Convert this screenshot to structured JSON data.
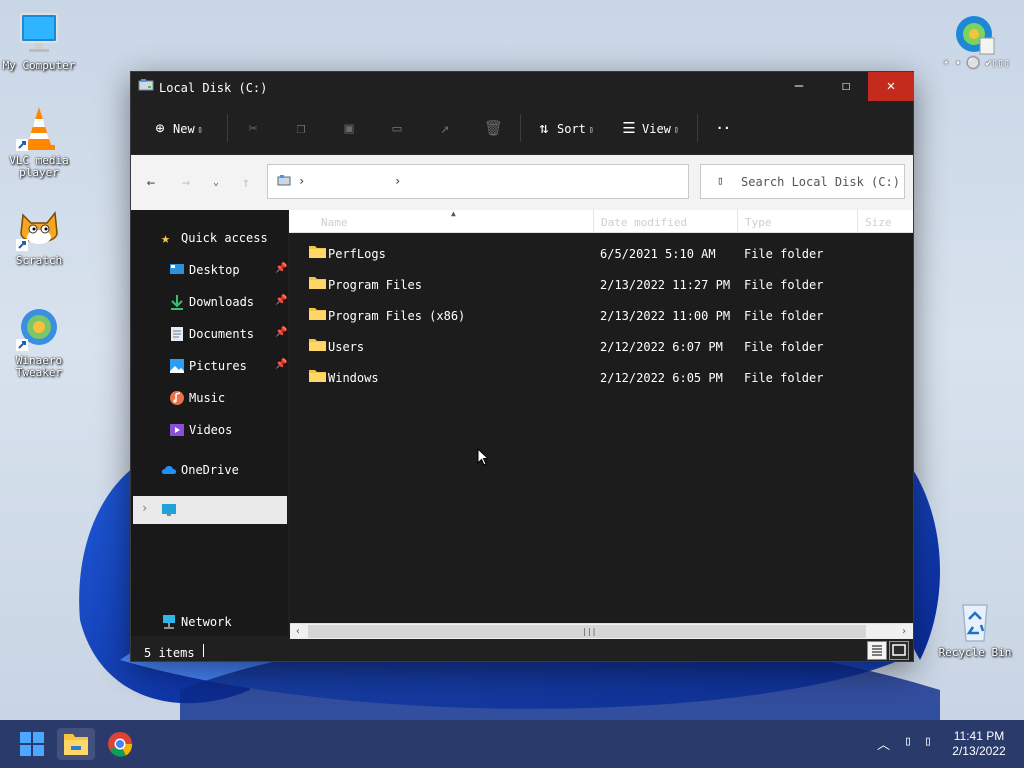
{
  "desktop": {
    "icons": [
      {
        "label": "My Computer",
        "icon": "monitor-icon"
      },
      {
        "label": "VLC media player",
        "icon": "vlc-cone-icon"
      },
      {
        "label": "Scratch",
        "icon": "scratch-cat-icon"
      },
      {
        "label": "Winaero Tweaker",
        "icon": "winaero-tweaker-icon"
      },
      {
        "label": "Recycle Bin",
        "icon": "recycle-bin-icon"
      }
    ],
    "corner_widget_text": "☀ • ⚪ ✔▯▯▯"
  },
  "window": {
    "title": "Local Disk (C:)",
    "controls": {
      "minimize": "—",
      "maximize": "☐",
      "close": "✕"
    },
    "colors": {
      "close_bg": "#c42b1c",
      "dark_bg": "#202020"
    }
  },
  "toolbar": {
    "new_label": "New",
    "sort_label": "Sort",
    "view_label": "View",
    "more_label": "··",
    "icons": [
      "add-circle-icon",
      "cut-icon",
      "copy-icon",
      "paste-icon",
      "rename-icon",
      "share-icon",
      "delete-icon",
      "sort-arrows-icon",
      "view-lines-icon"
    ]
  },
  "address": {
    "chevron": "›",
    "search_placeholder": "Search Local Disk (C:)",
    "search_icon": "▯"
  },
  "navpane": {
    "quick_access": "Quick access",
    "items": [
      {
        "label": "Desktop",
        "icon": "desktop-icon",
        "pinned": true
      },
      {
        "label": "Downloads",
        "icon": "download-icon",
        "pinned": true
      },
      {
        "label": "Documents",
        "icon": "document-icon",
        "pinned": true
      },
      {
        "label": "Pictures",
        "icon": "pictures-icon",
        "pinned": true
      },
      {
        "label": "Music",
        "icon": "music-icon",
        "pinned": false
      },
      {
        "label": "Videos",
        "icon": "videos-icon",
        "pinned": false
      }
    ],
    "onedrive": "OneDrive",
    "this_pc_expander": "›",
    "network": "Network"
  },
  "columns": [
    "Name",
    "Date modified",
    "Type",
    "Size"
  ],
  "files": [
    {
      "name": "PerfLogs",
      "date": "6/5/2021 5:10 AM",
      "type": "File folder"
    },
    {
      "name": "Program Files",
      "date": "2/13/2022 11:27 PM",
      "type": "File folder"
    },
    {
      "name": "Program Files (x86)",
      "date": "2/13/2022 11:00 PM",
      "type": "File folder"
    },
    {
      "name": "Users",
      "date": "2/12/2022 6:07 PM",
      "type": "File folder"
    },
    {
      "name": "Windows",
      "date": "2/12/2022 6:05 PM",
      "type": "File folder"
    }
  ],
  "scrollbar": {
    "left": "‹",
    "right": "›",
    "grip": "|||"
  },
  "status": {
    "items": "5 items"
  },
  "taskbar": {
    "apps": [
      "start-icon",
      "file-explorer-icon",
      "chrome-icon"
    ],
    "tray": {
      "chevron": "︿",
      "icon_a": "▯",
      "icon_b": "▯"
    },
    "time": "11:41 PM",
    "date": "2/13/2022"
  }
}
